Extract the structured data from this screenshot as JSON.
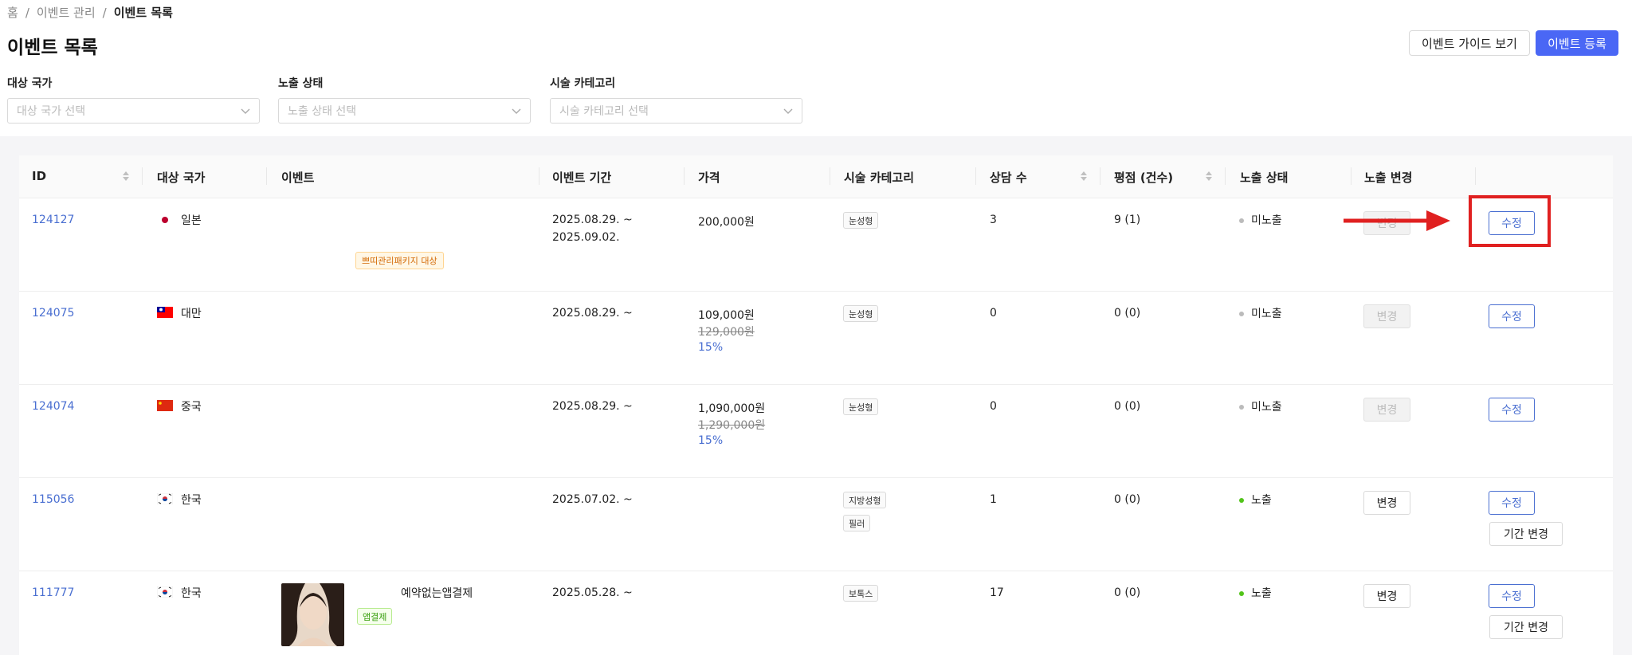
{
  "breadcrumb": {
    "home": "홈",
    "sep": "/",
    "section": "이벤트 관리",
    "current": "이벤트 목록"
  },
  "page": {
    "title": "이벤트 목록",
    "guide_button": "이벤트 가이드 보기",
    "register_button": "이벤트 등록"
  },
  "filters": [
    {
      "label": "대상 국가",
      "placeholder": "대상 국가 선택"
    },
    {
      "label": "노출 상태",
      "placeholder": "노출 상태 선택"
    },
    {
      "label": "시술 카테고리",
      "placeholder": "시술 카테고리 선택"
    }
  ],
  "table": {
    "headers": [
      "ID",
      "대상 국가",
      "이벤트",
      "이벤트 기간",
      "가격",
      "시술 카테고리",
      "상담 수",
      "평점 (건수)",
      "노출 상태",
      "노출 변경"
    ],
    "change_label": "변경",
    "edit_label": "수정",
    "period_change_label": "기간 변경",
    "rows": [
      {
        "id": "124127",
        "country": "일본",
        "flag": "japan-flag-icon",
        "promo_tag": "쁘띠관리패키지 대상",
        "period_start": "2025.08.29. ~",
        "period_end": "2025.09.02.",
        "price": "200,000원",
        "categories": [
          "눈성형"
        ],
        "consults": "3",
        "rating": "9 (1)",
        "status": "미노출",
        "status_color": "#bbbbbb"
      },
      {
        "id": "124075",
        "country": "대만",
        "flag": "taiwan-flag-icon",
        "period_start": "2025.08.29. ~",
        "price": "109,000원",
        "original_price": "129,000원",
        "discount": "15%",
        "categories": [
          "눈성형"
        ],
        "consults": "0",
        "rating": "0 (0)",
        "status": "미노출",
        "status_color": "#bbbbbb"
      },
      {
        "id": "124074",
        "country": "중국",
        "flag": "china-flag-icon",
        "period_start": "2025.08.29. ~",
        "price": "1,090,000원",
        "original_price": "1,290,000원",
        "discount": "15%",
        "categories": [
          "눈성형"
        ],
        "consults": "0",
        "rating": "0 (0)",
        "status": "미노출",
        "status_color": "#bbbbbb"
      },
      {
        "id": "115056",
        "country": "한국",
        "flag": "korea-flag-icon",
        "period_start": "2025.07.02. ~",
        "categories": [
          "지방성형",
          "필러"
        ],
        "consults": "1",
        "rating": "0 (0)",
        "status": "노출",
        "status_color": "#52c41a"
      },
      {
        "id": "111777",
        "country": "한국",
        "flag": "korea-flag-icon",
        "event_title": "예약없는앱결제",
        "event_tag": "앱결제",
        "period_start": "2025.05.28. ~",
        "categories": [
          "보톡스"
        ],
        "consults": "17",
        "rating": "0 (0)",
        "status": "노출",
        "status_color": "#52c41a"
      }
    ]
  },
  "colors": {
    "accent": "#4a67f5",
    "link": "#4a6fd1",
    "annotation": "#e02020"
  }
}
